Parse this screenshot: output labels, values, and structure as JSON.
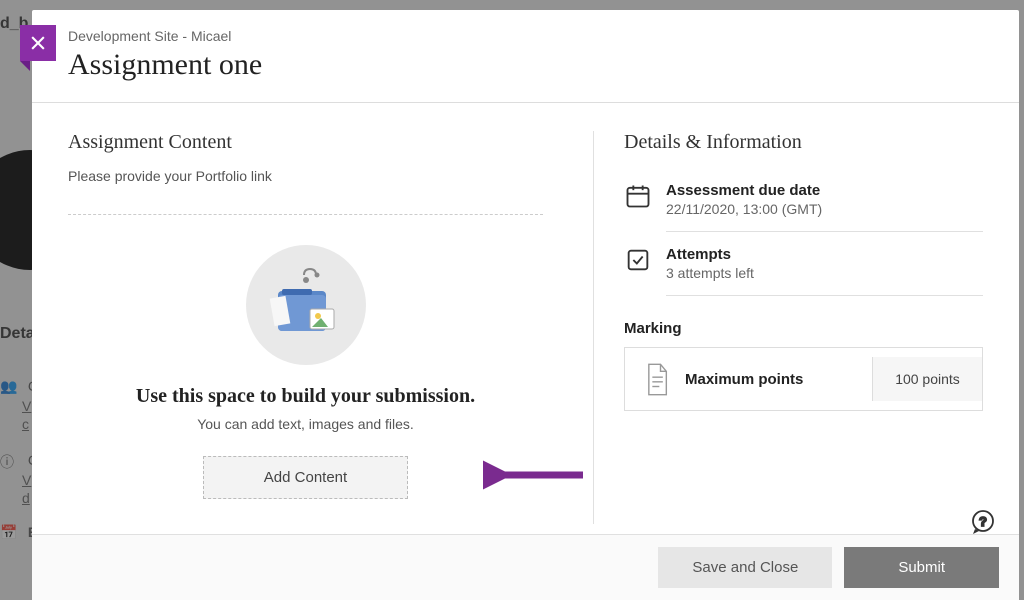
{
  "header": {
    "breadcrumb": "Development Site - Micael",
    "title": "Assignment one"
  },
  "content": {
    "section_title": "Assignment Content",
    "instruction": "Please provide your Portfolio link",
    "submission_heading": "Use this space to build your submission.",
    "submission_sub": "You can add text, images and files.",
    "add_content_label": "Add Content"
  },
  "details": {
    "section_title": "Details & Information",
    "due_date_label": "Assessment due date",
    "due_date_value": "22/11/2020, 13:00 (GMT)",
    "attempts_label": "Attempts",
    "attempts_value": "3 attempts left",
    "marking_title": "Marking",
    "max_points_label": "Maximum points",
    "max_points_value": "100 points"
  },
  "footer": {
    "save_close_label": "Save and Close",
    "submit_label": "Submit"
  },
  "backdrop": {
    "tab": "Deta",
    "c1": "C",
    "v1": "V",
    "c2": "c",
    "c3": "C",
    "v2": "V",
    "d1": "d",
    "b1": "B"
  }
}
